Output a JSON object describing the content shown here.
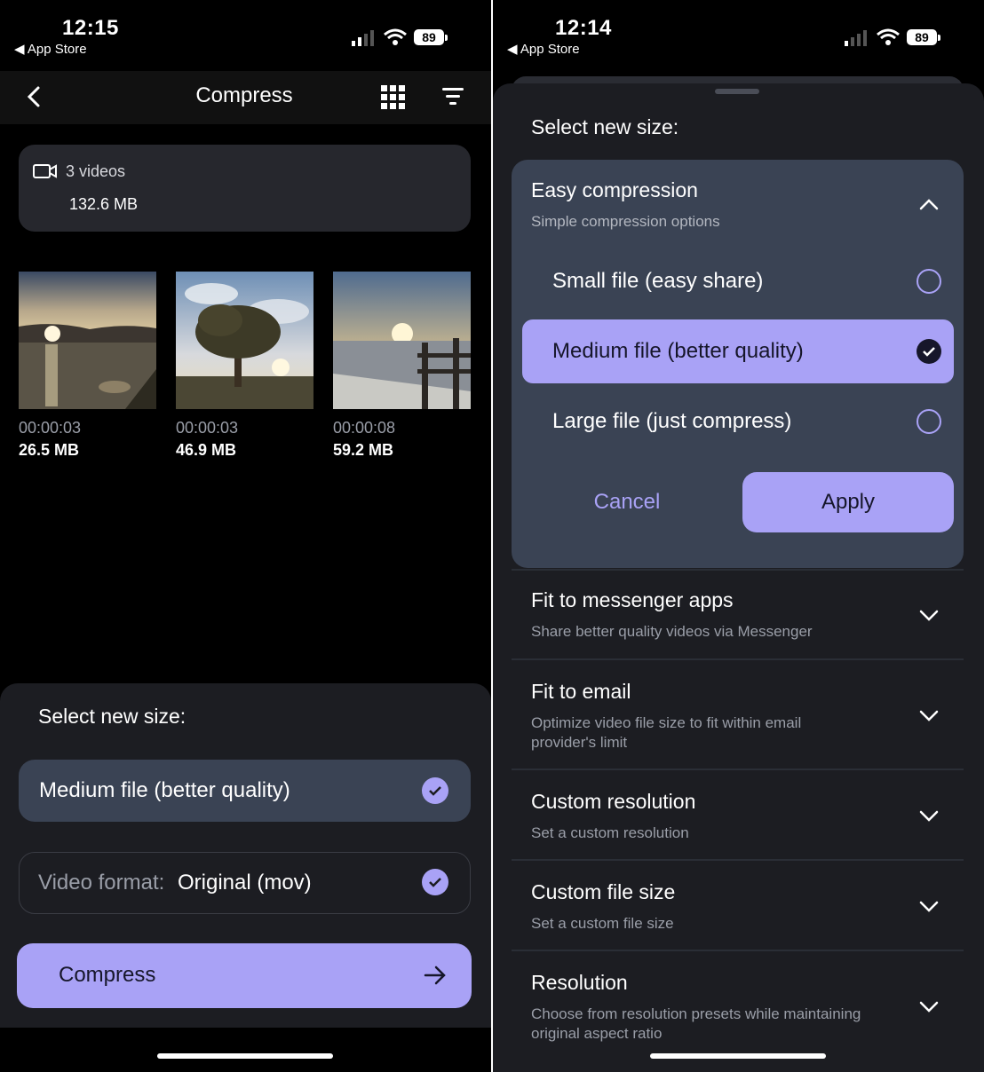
{
  "left": {
    "status": {
      "time": "12:15",
      "back_label": "App Store",
      "battery": "89"
    },
    "nav": {
      "title": "Compress"
    },
    "summary": {
      "count_label": "3 videos",
      "total_size": "132.6 MB"
    },
    "videos": [
      {
        "duration": "00:00:03",
        "size": "26.5 MB"
      },
      {
        "duration": "00:00:03",
        "size": "46.9 MB"
      },
      {
        "duration": "00:00:08",
        "size": "59.2 MB"
      }
    ],
    "sheet": {
      "title": "Select new size:",
      "size_option": "Medium file (better quality)",
      "format_label": "Video format:",
      "format_value": "Original (mov)",
      "compress_label": "Compress"
    }
  },
  "right": {
    "status": {
      "time": "12:14",
      "back_label": "App Store",
      "battery": "89"
    },
    "sheet_title": "Select new size:",
    "easy": {
      "title": "Easy compression",
      "subtitle": "Simple compression options",
      "options": [
        {
          "label": "Small file (easy share)",
          "selected": false
        },
        {
          "label": "Medium file (better quality)",
          "selected": true
        },
        {
          "label": "Large file (just compress)",
          "selected": false
        }
      ],
      "cancel_label": "Cancel",
      "apply_label": "Apply"
    },
    "sections": [
      {
        "title": "Fit to messenger apps",
        "subtitle": "Share better quality videos via Messenger"
      },
      {
        "title": "Fit to email",
        "subtitle": "Optimize video file size to fit within email provider's limit"
      },
      {
        "title": "Custom resolution",
        "subtitle": "Set a custom resolution"
      },
      {
        "title": "Custom file size",
        "subtitle": "Set a custom file size"
      },
      {
        "title": "Resolution",
        "subtitle": "Choose from resolution presets while maintaining original aspect ratio"
      }
    ]
  },
  "colors": {
    "accent": "#a9a2f6",
    "sheet": "#1c1d22",
    "panel": "#3a4354",
    "card": "#26272d"
  }
}
